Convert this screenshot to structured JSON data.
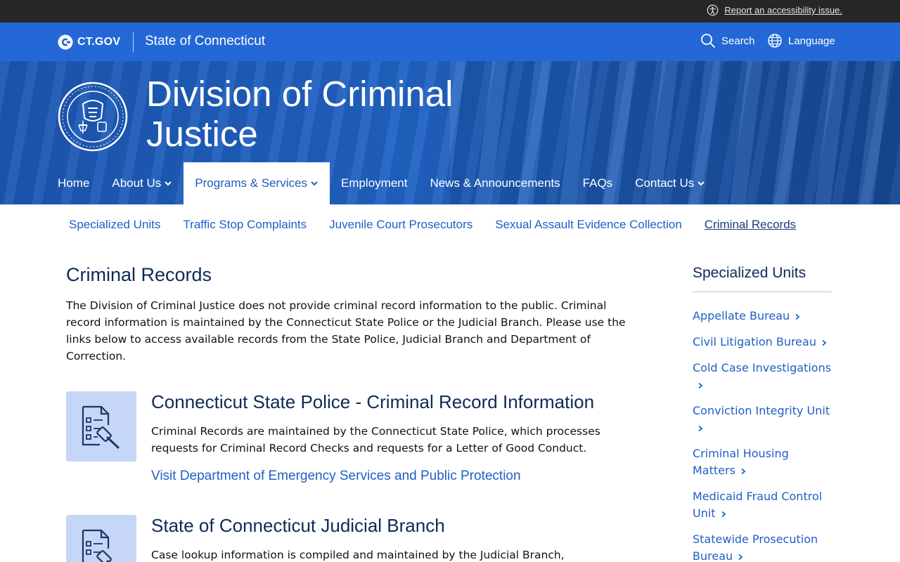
{
  "topbar": {
    "accessibility_link": "Report an accessibility issue."
  },
  "header": {
    "logo_text": "CT.GOV",
    "state_name": "State of Connecticut",
    "search_label": "Search",
    "language_label": "Language"
  },
  "hero": {
    "title": "Division of Criminal Justice",
    "seal_alt": "Division of Criminal Justice seal"
  },
  "main_nav": {
    "items": [
      {
        "label": "Home"
      },
      {
        "label": "About Us"
      },
      {
        "label": "Programs & Services"
      },
      {
        "label": "Employment"
      },
      {
        "label": "News & Announcements"
      },
      {
        "label": "FAQs"
      },
      {
        "label": "Contact Us"
      }
    ]
  },
  "sub_nav": {
    "items": [
      {
        "label": "Specialized Units"
      },
      {
        "label": "Traffic Stop Complaints"
      },
      {
        "label": "Juvenile Court Prosecutors"
      },
      {
        "label": "Sexual Assault Evidence Collection"
      },
      {
        "label": "Criminal Records"
      }
    ]
  },
  "main": {
    "title": "Criminal Records",
    "intro": "The Division of Criminal Justice does not provide criminal record information to the public. Criminal record information is maintained by the Connecticut State Police or the Judicial Branch. Please use the links below to access available records from the State Police, Judicial Branch and Department of Correction.",
    "cards": [
      {
        "title": "Connecticut State Police - Criminal Record Information",
        "body": "Criminal Records are maintained by the Connecticut State Police, which processes requests for Criminal Record Checks and requests for a Letter of Good Conduct.",
        "link": "Visit Department of Emergency Services and Public Protection"
      },
      {
        "title": "State of Connecticut Judicial Branch",
        "body": "Case lookup information is compiled and maintained by the Judicial Branch,"
      }
    ]
  },
  "sidebar": {
    "title": "Specialized Units",
    "items": [
      {
        "label": "Appellate Bureau"
      },
      {
        "label": "Civil Litigation Bureau"
      },
      {
        "label": "Cold Case Investigations"
      },
      {
        "label": "Conviction Integrity Unit"
      },
      {
        "label": "Criminal Housing Matters"
      },
      {
        "label": "Medicaid Fraud Control Unit"
      },
      {
        "label": "Statewide Prosecution Bureau"
      }
    ]
  },
  "colors": {
    "topbar": "#262626",
    "header_blue": "#2467d6",
    "link_blue": "#1f5fc6",
    "heading_navy": "#0e2a55",
    "tile_bg": "#c5d6f7"
  }
}
